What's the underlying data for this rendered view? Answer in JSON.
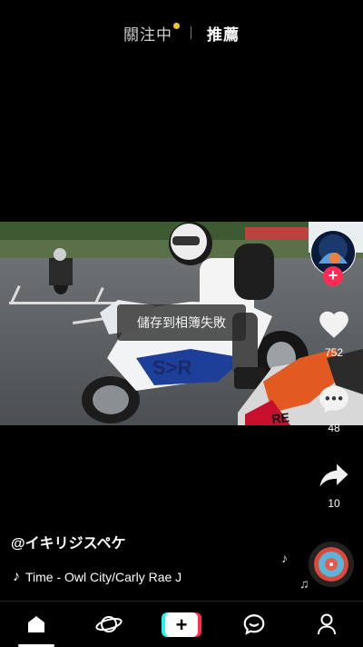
{
  "top_tabs": {
    "following": "關注中",
    "recommended": "推薦"
  },
  "toast": "儲存到相簿失敗",
  "actions": {
    "likes": "752",
    "comments": "48",
    "shares": "10"
  },
  "caption": {
    "author": "@イキリジスペケ",
    "music": "Time - Owl City/Carly Rae J"
  },
  "icons": {
    "tab_dot": "notification-dot",
    "like": "heart-icon",
    "comment": "comment-icon",
    "share": "share-arrow-icon",
    "home": "home-icon",
    "discover": "planet-icon",
    "create": "plus-icon",
    "inbox": "chat-bubble-icon",
    "profile": "person-icon"
  },
  "colors": {
    "accent_red": "#fe2c55",
    "accent_cyan": "#25f4ee",
    "dot_yellow": "#f7c331"
  }
}
